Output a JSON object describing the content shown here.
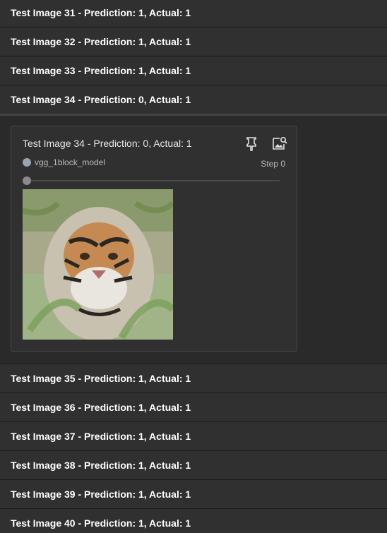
{
  "rows_before": [
    {
      "label": "Test Image 31 - Prediction: 1, Actual: 1"
    },
    {
      "label": "Test Image 32 - Prediction: 1, Actual: 1"
    },
    {
      "label": "Test Image 33 - Prediction: 1, Actual: 1"
    }
  ],
  "expanded_row": {
    "label": "Test Image 34 - Prediction: 0, Actual: 1"
  },
  "card": {
    "title": "Test Image 34 - Prediction: 0, Actual: 1",
    "run_name": "vgg_1block_model",
    "run_color": "#9aa5b1",
    "step_label": "Step 0",
    "slider_value": 0,
    "pin_icon": "pin-icon",
    "image_search_icon": "image-search-icon",
    "image_subject": "tiger"
  },
  "rows_after": [
    {
      "label": "Test Image 35 - Prediction: 1, Actual: 1"
    },
    {
      "label": "Test Image 36 - Prediction: 1, Actual: 1"
    },
    {
      "label": "Test Image 37 - Prediction: 1, Actual: 1"
    },
    {
      "label": "Test Image 38 - Prediction: 1, Actual: 1"
    },
    {
      "label": "Test Image 39 - Prediction: 1, Actual: 1"
    },
    {
      "label": "Test Image 40 - Prediction: 1, Actual: 1"
    }
  ]
}
